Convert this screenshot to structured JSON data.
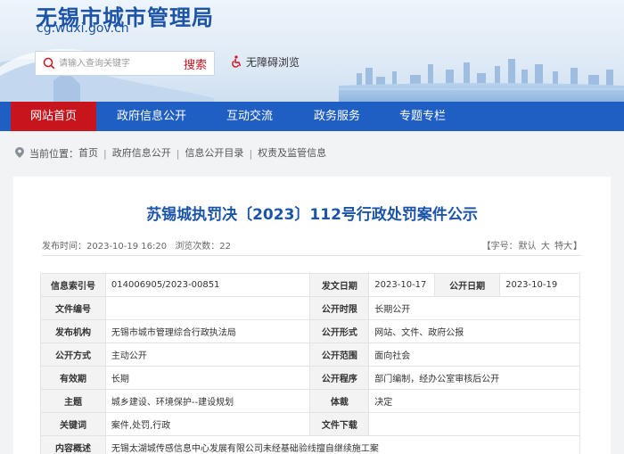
{
  "header": {
    "site_title": "无锡市城市管理局",
    "site_domain": "cg.wuxi.gov.cn",
    "search_placeholder": "请输入查询关键字",
    "search_label": "搜索",
    "accessibility_label": "无障碍浏览"
  },
  "nav": {
    "items": [
      {
        "label": "网站首页",
        "active": true
      },
      {
        "label": "政府信息公开"
      },
      {
        "label": "互动交流"
      },
      {
        "label": "政务服务"
      },
      {
        "label": "专题专栏"
      }
    ]
  },
  "breadcrumb": {
    "prefix": "当前位置：",
    "items": [
      "首页",
      "政府信息公开",
      "信息公开目录",
      "权责及监管信息"
    ]
  },
  "article": {
    "title": "苏锡城执罚决〔2023〕112号行政处罚案件公示",
    "publish_time": "发布时间：2023-10-19 16:20",
    "views": "浏览次数：22",
    "font_size_prefix": "【字号：",
    "font_size_default": "默认",
    "font_size_large": "大",
    "font_size_xlarge": "特大",
    "font_size_suffix": "】"
  },
  "info_table": {
    "rows": [
      {
        "k1": "信息索引号",
        "v1": "014006905/2023-00851",
        "k2": "发文日期",
        "v2": "2023-10-17",
        "k3": "公开日期",
        "v3": "2023-10-19"
      },
      {
        "k1": "文件编号",
        "v1": "",
        "k2": "公开时限",
        "v2": "长期公开"
      },
      {
        "k1": "发布机构",
        "v1": "无锡市城市管理综合行政执法局",
        "k2": "公开形式",
        "v2": "网站、文件、政府公报"
      },
      {
        "k1": "公开方式",
        "v1": "主动公开",
        "k2": "公开范围",
        "v2": "面向社会"
      },
      {
        "k1": "有效期",
        "v1": "长期",
        "k2": "公开程序",
        "v2": "部门编制，经办公室审核后公开"
      },
      {
        "k1": "主题",
        "v1": "城乡建设、环境保护--建设规划",
        "k2": "体裁",
        "v2": "决定"
      },
      {
        "k1": "关键词",
        "v1": "案件,处罚,行政",
        "k2": "文件下载",
        "v2": ""
      },
      {
        "k1": "内容概述",
        "v1": "无锡太湖城传感信息中心发展有限公司未经基础验线擅自继续施工案"
      }
    ]
  },
  "colors": {
    "brand_blue": "#1f5ec2",
    "active_red": "#c8141d",
    "title_blue": "#1c54a8"
  }
}
